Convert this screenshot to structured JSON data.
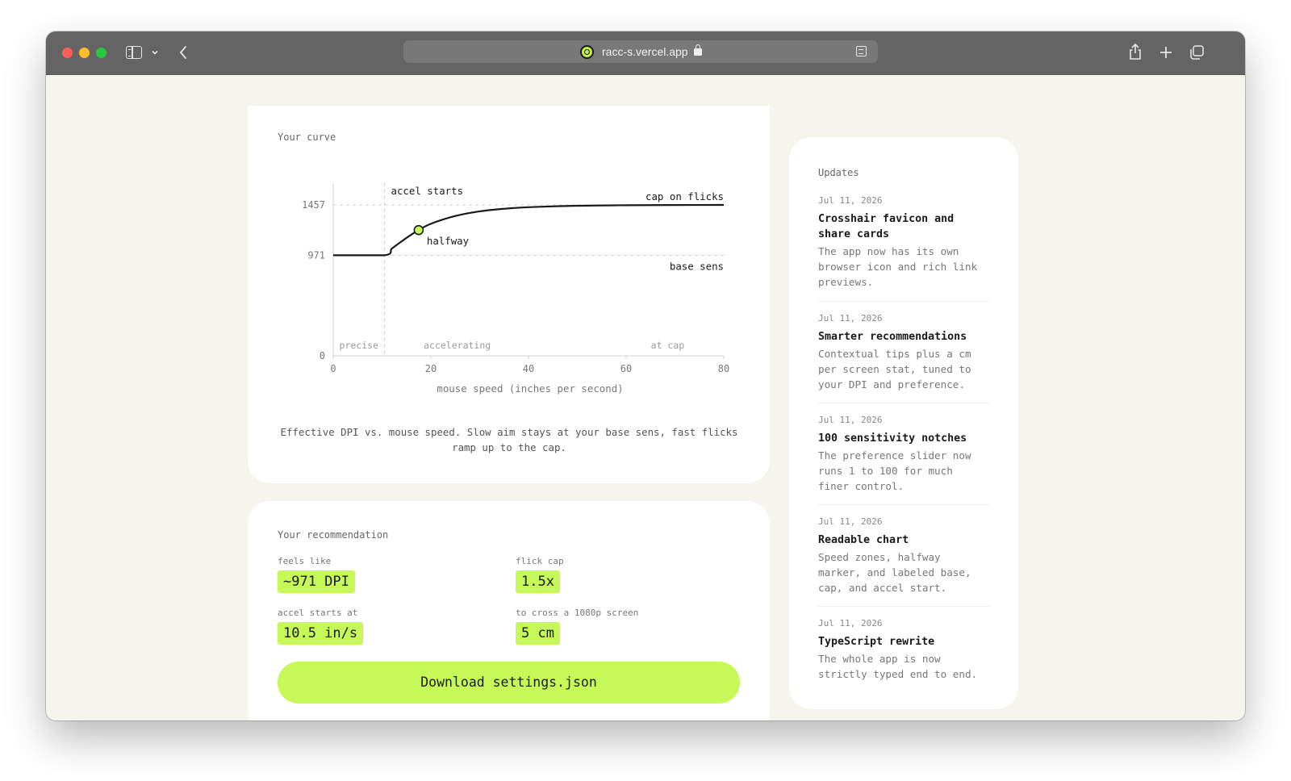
{
  "browser": {
    "url": "racc-s.vercel.app"
  },
  "curve": {
    "section_label": "Your curve",
    "caption": "Effective DPI vs. mouse speed. Slow aim stays at your base sens, fast flicks ramp up to the cap."
  },
  "chart_data": {
    "type": "line",
    "xlabel": "mouse speed (inches per second)",
    "ylabel": "",
    "xlim": [
      0,
      80
    ],
    "ylim": [
      0,
      1457
    ],
    "x_ticks": [
      "0",
      "20",
      "40",
      "60",
      "80"
    ],
    "y_ticks": [
      "0",
      "971",
      "1457"
    ],
    "series": [
      {
        "x": [
          0,
          10.5,
          12,
          14,
          16,
          17.5,
          20,
          25,
          30,
          35,
          40,
          50,
          60,
          70,
          80
        ],
        "y": [
          971,
          971,
          1035,
          1105,
          1170,
          1214,
          1275,
          1350,
          1395,
          1420,
          1435,
          1449,
          1454,
          1456,
          1457
        ]
      }
    ],
    "accel_start": 10.5,
    "halfway_point": {
      "x": 17.5,
      "y": 1214
    },
    "reference_lines": [
      {
        "y": 1457,
        "label": "cap on flicks"
      },
      {
        "y": 971,
        "label": "base sens"
      }
    ],
    "annotations": {
      "accel_starts": "accel starts",
      "halfway": "halfway"
    },
    "zones": [
      "precise",
      "accelerating",
      "at cap"
    ]
  },
  "recommendation": {
    "section_label": "Your recommendation",
    "feels_like_label": "feels like",
    "feels_like_value": "~971 DPI",
    "flick_cap_label": "flick cap",
    "flick_cap_value": "1.5x",
    "accel_label": "accel starts at",
    "accel_value": "10.5 in/s",
    "cross_label": "to cross a 1080p screen",
    "cross_value": "5 cm",
    "download_label": "Download settings.json"
  },
  "updates": {
    "title": "Updates",
    "items": [
      {
        "date": "Jul 11, 2026",
        "title": "Crosshair favicon and share cards",
        "desc": "The app now has its own browser icon and rich link previews."
      },
      {
        "date": "Jul 11, 2026",
        "title": "Smarter recommendations",
        "desc": "Contextual tips plus a cm per screen stat, tuned to your DPI and preference."
      },
      {
        "date": "Jul 11, 2026",
        "title": "100 sensitivity notches",
        "desc": "The preference slider now runs 1 to 100 for much finer control."
      },
      {
        "date": "Jul 11, 2026",
        "title": "Readable chart",
        "desc": "Speed zones, halfway marker, and labeled base, cap, and accel start."
      },
      {
        "date": "Jul 11, 2026",
        "title": "TypeScript rewrite",
        "desc": "The whole app is now strictly typed end to end."
      }
    ]
  }
}
